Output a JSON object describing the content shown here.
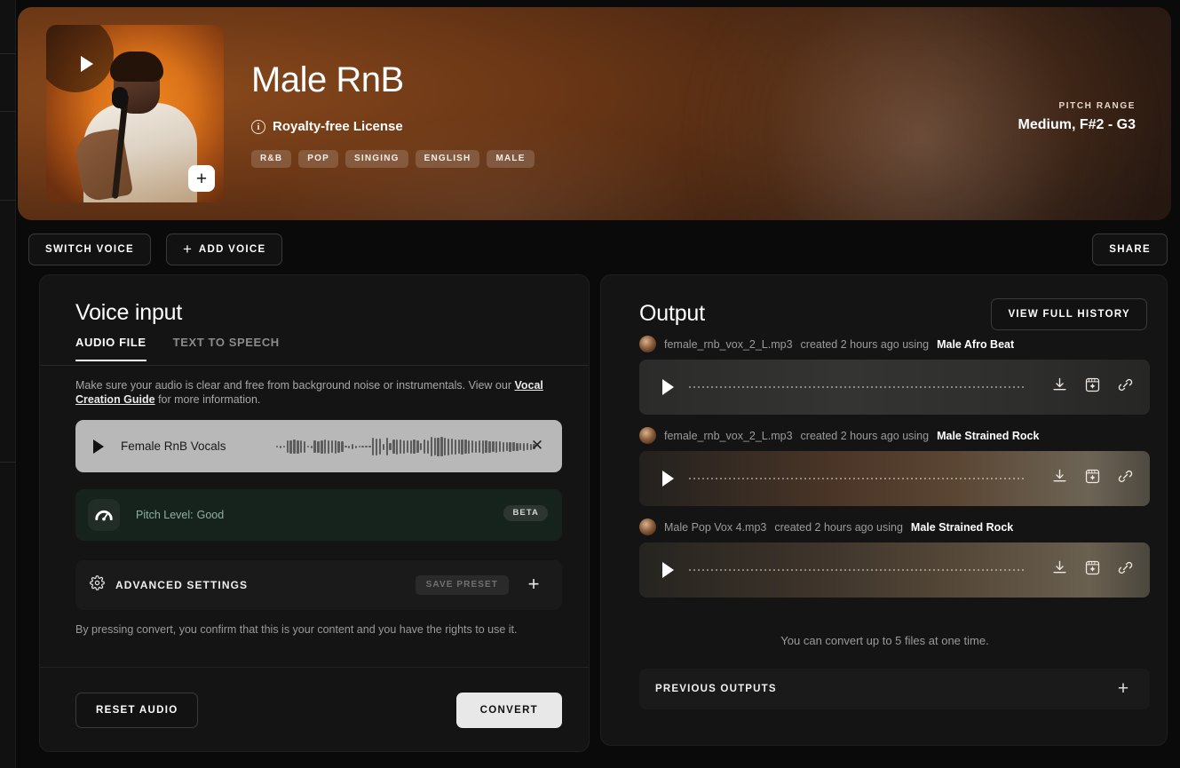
{
  "hero": {
    "title": "Male RnB",
    "license": "Royalty-free License",
    "info_icon": "info-icon",
    "tags": [
      "R&B",
      "POP",
      "SINGING",
      "ENGLISH",
      "MALE"
    ],
    "pitch_range_label": "PITCH RANGE",
    "pitch_range_value": "Medium, F#2 - G3",
    "thumb_play_icon": "play-icon",
    "thumb_add_icon": "plus-icon"
  },
  "toolbar": {
    "switch_voice": "SWITCH VOICE",
    "add_voice": "ADD VOICE",
    "add_voice_icon": "plus-icon",
    "share": "SHARE"
  },
  "voice_input": {
    "title": "Voice input",
    "tabs": [
      {
        "label": "AUDIO FILE",
        "active": true
      },
      {
        "label": "TEXT TO SPEECH",
        "active": false
      }
    ],
    "helper_pre": "Make sure your audio is clear and free from background noise or instrumentals. View our ",
    "helper_link": "Vocal Creation Guide",
    "helper_post": " for more information.",
    "audio_file": {
      "name": "Female RnB Vocals",
      "play_icon": "play-icon",
      "remove_icon": "close-icon"
    },
    "pitch": {
      "icon": "gauge-icon",
      "label": "Pitch Level:",
      "value": "Good",
      "badge": "BETA"
    },
    "advanced": {
      "icon": "gear-icon",
      "label": "ADVANCED SETTINGS",
      "save_preset": "SAVE PRESET",
      "expand_icon": "plus-icon"
    },
    "legal": "By pressing convert, you confirm that this is your content and you have the rights to use it.",
    "reset": "RESET AUDIO",
    "convert": "CONVERT"
  },
  "output": {
    "title": "Output",
    "view_history": "VIEW FULL HISTORY",
    "items": [
      {
        "filename": "female_rnb_vox_2_L.mp3",
        "created": "created 2 hours ago using",
        "voice": "Male Afro Beat",
        "avatar": "avatar",
        "play_icon": "play-icon",
        "download_icon": "download-icon",
        "studio_icon": "studio-icon",
        "link_icon": "link-icon"
      },
      {
        "filename": "female_rnb_vox_2_L.mp3",
        "created": "created 2 hours ago using",
        "voice": "Male Strained Rock",
        "avatar": "avatar",
        "play_icon": "play-icon",
        "download_icon": "download-icon",
        "studio_icon": "studio-icon",
        "link_icon": "link-icon"
      },
      {
        "filename": "Male Pop Vox 4.mp3",
        "created": "created 2 hours ago using",
        "voice": "Male Strained Rock",
        "avatar": "avatar",
        "play_icon": "play-icon",
        "download_icon": "download-icon",
        "studio_icon": "studio-icon",
        "link_icon": "link-icon"
      }
    ],
    "limit_note": "You can convert up to 5 files at one time.",
    "previous_outputs": "PREVIOUS OUTPUTS",
    "previous_expand_icon": "plus-icon"
  },
  "colors": {
    "accent_orange": "#d9711a",
    "panel_bg": "#141414",
    "page_bg": "#0a0a0a",
    "convert_btn": "#e8e8e8",
    "pitch_card": "#15231c"
  }
}
